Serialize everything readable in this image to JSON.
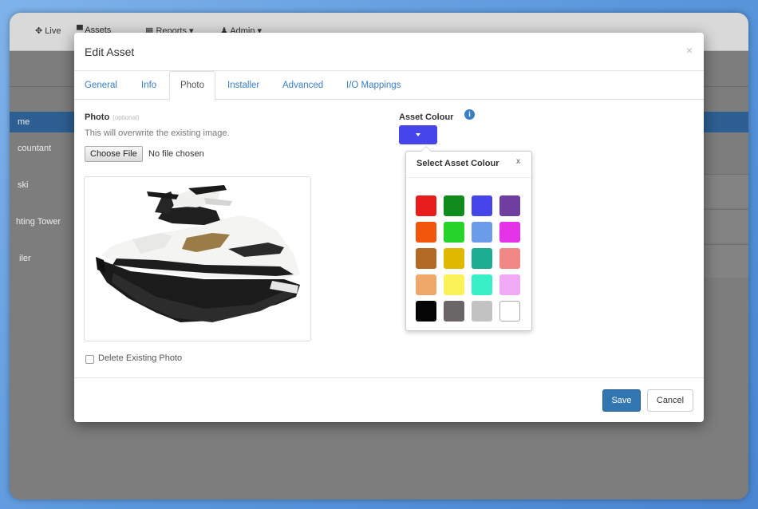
{
  "app": {
    "nav": [
      {
        "label": "Live",
        "icon": "move-icon"
      },
      {
        "label": "Assets",
        "icon": "truck-icon"
      },
      {
        "label": "Reports",
        "icon": "calendar-icon"
      },
      {
        "label": "Admin",
        "icon": "user-icon"
      }
    ],
    "sidebar": [
      "me",
      "countant",
      "ski",
      "hting Tower",
      "iler"
    ]
  },
  "modal": {
    "title": "Edit Asset",
    "close": "×",
    "tabs": [
      "General",
      "Info",
      "Photo",
      "Installer",
      "Advanced",
      "I/O Mappings"
    ],
    "active_tab": "Photo",
    "photo": {
      "label": "Photo",
      "optional": "(optional)",
      "help": "This will overwrite the existing image.",
      "choose_file": "Choose File",
      "no_file": "No file chosen",
      "delete_label": "Delete Existing Photo"
    },
    "colour": {
      "label": "Asset Colour",
      "info_icon": "i",
      "selected": "#4545ea",
      "picker_title": "Select Asset Colour",
      "picker_close": "x",
      "swatches": [
        "#e81e1e",
        "#0f8c1c",
        "#4545ea",
        "#6f3fa0",
        "#f2560c",
        "#27d42a",
        "#6b9cea",
        "#e434e8",
        "#b36a26",
        "#e0b800",
        "#1cae93",
        "#f08888",
        "#f0a86a",
        "#fbf25a",
        "#38f0c8",
        "#f0aaf4",
        "#050505",
        "#6a6668",
        "#c2c2c2",
        "#ffffff"
      ]
    },
    "footer": {
      "save": "Save",
      "cancel": "Cancel"
    }
  }
}
